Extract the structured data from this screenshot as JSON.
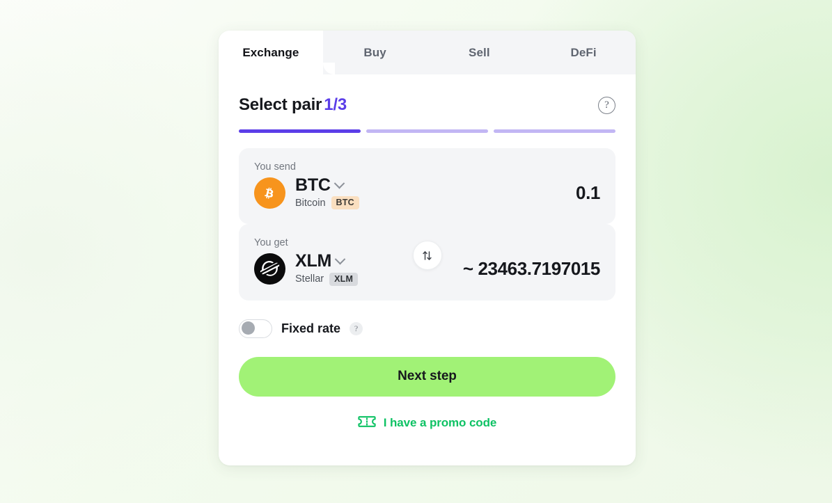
{
  "tabs": [
    {
      "label": "Exchange",
      "active": true
    },
    {
      "label": "Buy",
      "active": false
    },
    {
      "label": "Sell",
      "active": false
    },
    {
      "label": "DeFi",
      "active": false
    }
  ],
  "header": {
    "title": "Select pair",
    "step": "1/3",
    "help_icon": "question-circle-icon",
    "accent_color": "#5b3ee8"
  },
  "progress": {
    "total_segments": 3,
    "completed_segments": 1,
    "active_color": "#5b3ee8",
    "inactive_color": "#c2b6f4"
  },
  "send": {
    "label": "You send",
    "ticker": "BTC",
    "coin_name": "Bitcoin",
    "network_badge": "BTC",
    "amount": "0.1",
    "logo_icon": "bitcoin-icon",
    "logo_color": "#f7941d",
    "badge_color": "#fadfc0",
    "dropdown_icon": "chevron-down-icon"
  },
  "swap": {
    "icon": "swap-vertical-icon"
  },
  "get": {
    "label": "You get",
    "ticker": "XLM",
    "coin_name": "Stellar",
    "network_badge": "XLM",
    "amount": "~ 23463.7197015",
    "logo_icon": "stellar-icon",
    "logo_color": "#0b0b0c",
    "badge_color": "#d8dade",
    "dropdown_icon": "chevron-down-icon"
  },
  "fixed_rate": {
    "label": "Fixed rate",
    "enabled": false,
    "help_icon": "question-mark-icon"
  },
  "cta": {
    "label": "Next step",
    "color": "#a1f276"
  },
  "promo": {
    "label": "I have a promo code",
    "icon": "ticket-icon",
    "color": "#0ec264"
  }
}
